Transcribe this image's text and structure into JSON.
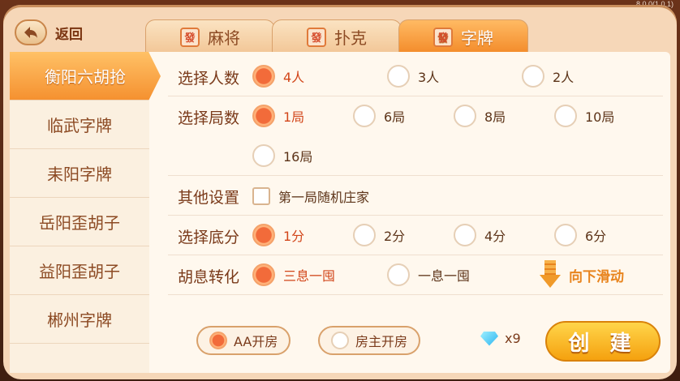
{
  "version": "8.0.0(1.0.1)",
  "header": {
    "back_label": "返回",
    "tabs": [
      {
        "label": "麻将",
        "icon": "發",
        "active": false
      },
      {
        "label": "扑克",
        "icon": "發",
        "active": false
      },
      {
        "label": "字牌",
        "icon": "發",
        "active": true
      }
    ]
  },
  "sidebar": {
    "items": [
      {
        "label": "衡阳六胡抢",
        "active": true
      },
      {
        "label": "临武字牌",
        "active": false
      },
      {
        "label": "耒阳字牌",
        "active": false
      },
      {
        "label": "岳阳歪胡子",
        "active": false
      },
      {
        "label": "益阳歪胡子",
        "active": false
      },
      {
        "label": "郴州字牌",
        "active": false
      }
    ]
  },
  "form": {
    "players": {
      "label": "选择人数",
      "options": [
        "4人",
        "3人",
        "2人"
      ],
      "selected": "4人"
    },
    "rounds": {
      "label": "选择局数",
      "options": [
        "1局",
        "6局",
        "8局",
        "10局",
        "16局"
      ],
      "selected": "1局"
    },
    "other": {
      "label": "其他设置",
      "checkbox": "第一局随机庄家",
      "checked": false
    },
    "base_score": {
      "label": "选择底分",
      "options": [
        "1分",
        "2分",
        "4分",
        "6分"
      ],
      "selected": "1分"
    },
    "hu_convert": {
      "label": "胡息转化",
      "options": [
        "三息一囤",
        "一息一囤"
      ],
      "selected": "三息一囤"
    },
    "scroll_hint": "向下滑动"
  },
  "bottom": {
    "pay_options": [
      "AA开房",
      "房主开房"
    ],
    "pay_selected": "AA开房",
    "gem_count": "x9",
    "create_label": "创 建"
  },
  "colors": {
    "accent": "#f38b2a",
    "selected_text": "#d2461a"
  }
}
